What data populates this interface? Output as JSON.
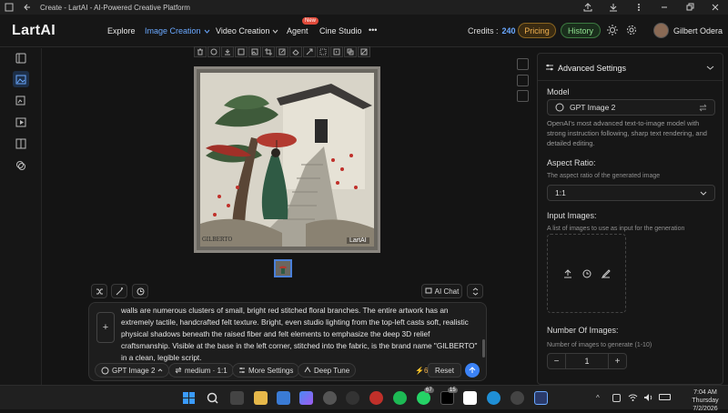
{
  "window": {
    "title": "Create - LartAI - AI-Powered Creative Platform"
  },
  "nav": {
    "logo": "LartAI",
    "items": [
      {
        "label": "Explore"
      },
      {
        "label": "Image Creation"
      },
      {
        "label": "Video Creation"
      },
      {
        "label": "Agent"
      },
      {
        "label": "Cine Studio"
      }
    ],
    "agent_badge": "New",
    "more": "•••",
    "credits_label": "Credits :",
    "credits_value": "240",
    "pricing": "Pricing",
    "history": "History",
    "user_name": "Gilbert Odera"
  },
  "image": {
    "watermark": "LartAI",
    "signature": "GILBERTO"
  },
  "chat": {
    "ai_chat": "AI Chat"
  },
  "prompt": {
    "text": "walls are numerous clusters of small, bright red stitched floral branches. The entire artwork has an extremely tactile, handcrafted felt texture. Bright, even studio lighting from the top-left casts soft, realistic physical shadows beneath the raised fiber and felt elements to emphasize the deep 3D relief craftsmanship. Visible at the base in the left corner, stitched into the fabric, is the brand name \"GILBERTO\" in a clean, legible script.",
    "plus": "+",
    "model": "GPT Image 2",
    "quality": "medium · 1:1",
    "more_settings": "More Settings",
    "deep_tune": "Deep Tune",
    "cost": "6",
    "reset": "Reset"
  },
  "settings": {
    "title": "Advanced Settings",
    "model_label": "Model",
    "model_value": "GPT Image 2",
    "model_desc": "OpenAI's most advanced text-to-image model with strong instruction following, sharp text rendering, and detailed editing.",
    "aspect_label": "Aspect Ratio:",
    "aspect_hint": "The aspect ratio of the generated image",
    "aspect_value": "1:1",
    "input_label": "Input Images:",
    "input_hint": "A list of images to use as input for the generation",
    "num_label": "Number Of Images:",
    "num_hint": "Number of images to generate (1-10)",
    "num_value": "1",
    "minus": "−",
    "plus": "+"
  },
  "taskbar": {
    "time": "7:04 AM",
    "day": "Thursday",
    "date": "7/2/2026",
    "badge1": "67",
    "badge2": "15"
  },
  "colors": {
    "accent": "#3b82f6",
    "pricing": "#f0b050",
    "history": "#8fe08f",
    "new_badge": "#e04a3a"
  }
}
